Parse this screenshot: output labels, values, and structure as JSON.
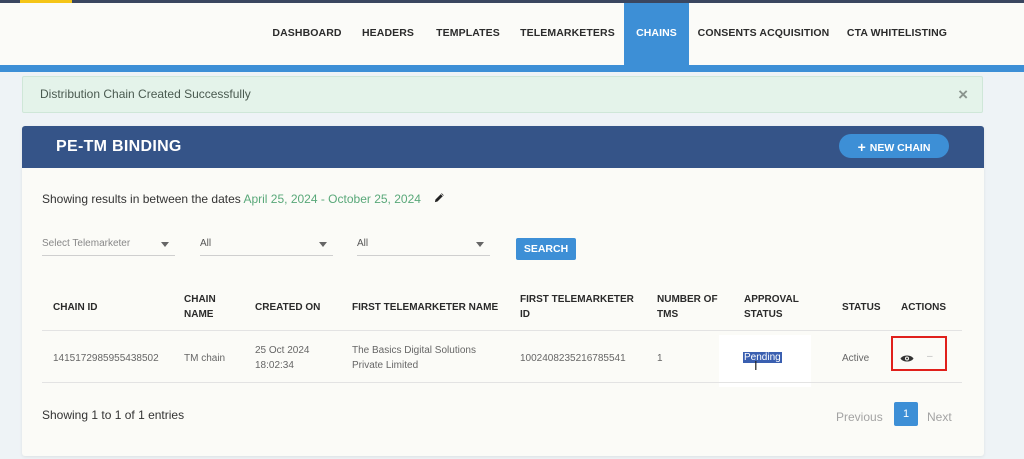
{
  "nav": {
    "items": [
      {
        "label": "DASHBOARD"
      },
      {
        "label": "HEADERS"
      },
      {
        "label": "TEMPLATES"
      },
      {
        "label": "TELEMARKETERS"
      },
      {
        "label": "CHAINS",
        "active": true
      },
      {
        "label": "CONSENTS ACQUISITION"
      },
      {
        "label": "CTA WHITELISTING"
      }
    ]
  },
  "alert": {
    "message": "Distribution Chain Created Successfully",
    "close": "×"
  },
  "card": {
    "title": "PE-TM BINDING",
    "new_chain_icon": "+",
    "new_chain_label": "NEW CHAIN"
  },
  "date_filter": {
    "prefix": "Showing results in between the dates",
    "range": "April 25, 2024 - October 25, 2024",
    "edit_icon": "pencil-icon"
  },
  "filters": {
    "telemarketer": {
      "placeholder": "Select Telemarketer"
    },
    "filter2": {
      "value": "All"
    },
    "filter3": {
      "value": "All"
    },
    "search_label": "SEARCH"
  },
  "table": {
    "headers": {
      "chain_id": "CHAIN ID",
      "chain_name_1": "CHAIN",
      "chain_name_2": "NAME",
      "created_on": "CREATED ON",
      "first_tm_name": "FIRST TELEMARKETER NAME",
      "first_tm_id_1": "FIRST TELEMARKETER",
      "first_tm_id_2": "ID",
      "num_tms_1": "NUMBER OF",
      "num_tms_2": "TMS",
      "approval_1": "APPROVAL",
      "approval_2": "STATUS",
      "status": "STATUS",
      "actions": "ACTIONS"
    },
    "rows": [
      {
        "chain_id": "1415172985955438502",
        "chain_name": "TM chain",
        "created_date": "25 Oct 2024",
        "created_time": "18:02:34",
        "first_tm_name_1": "The Basics Digital Solutions",
        "first_tm_name_2": "Private Limited",
        "first_tm_id": "1002408235216785541",
        "num_tms": "1",
        "approval_status": "Pending",
        "status": "Active",
        "action_view_icon": "eye-icon",
        "action_other": "–"
      }
    ]
  },
  "footer": {
    "entries": "Showing 1 to 1 of 1 entries",
    "previous": "Previous",
    "page": "1",
    "next": "Next"
  },
  "colors": {
    "brand_blue": "#3d8fd6",
    "header_navy": "#355488",
    "success_bg": "#e4f3ea",
    "date_green": "#59a879",
    "highlight_red": "#e0201b"
  }
}
